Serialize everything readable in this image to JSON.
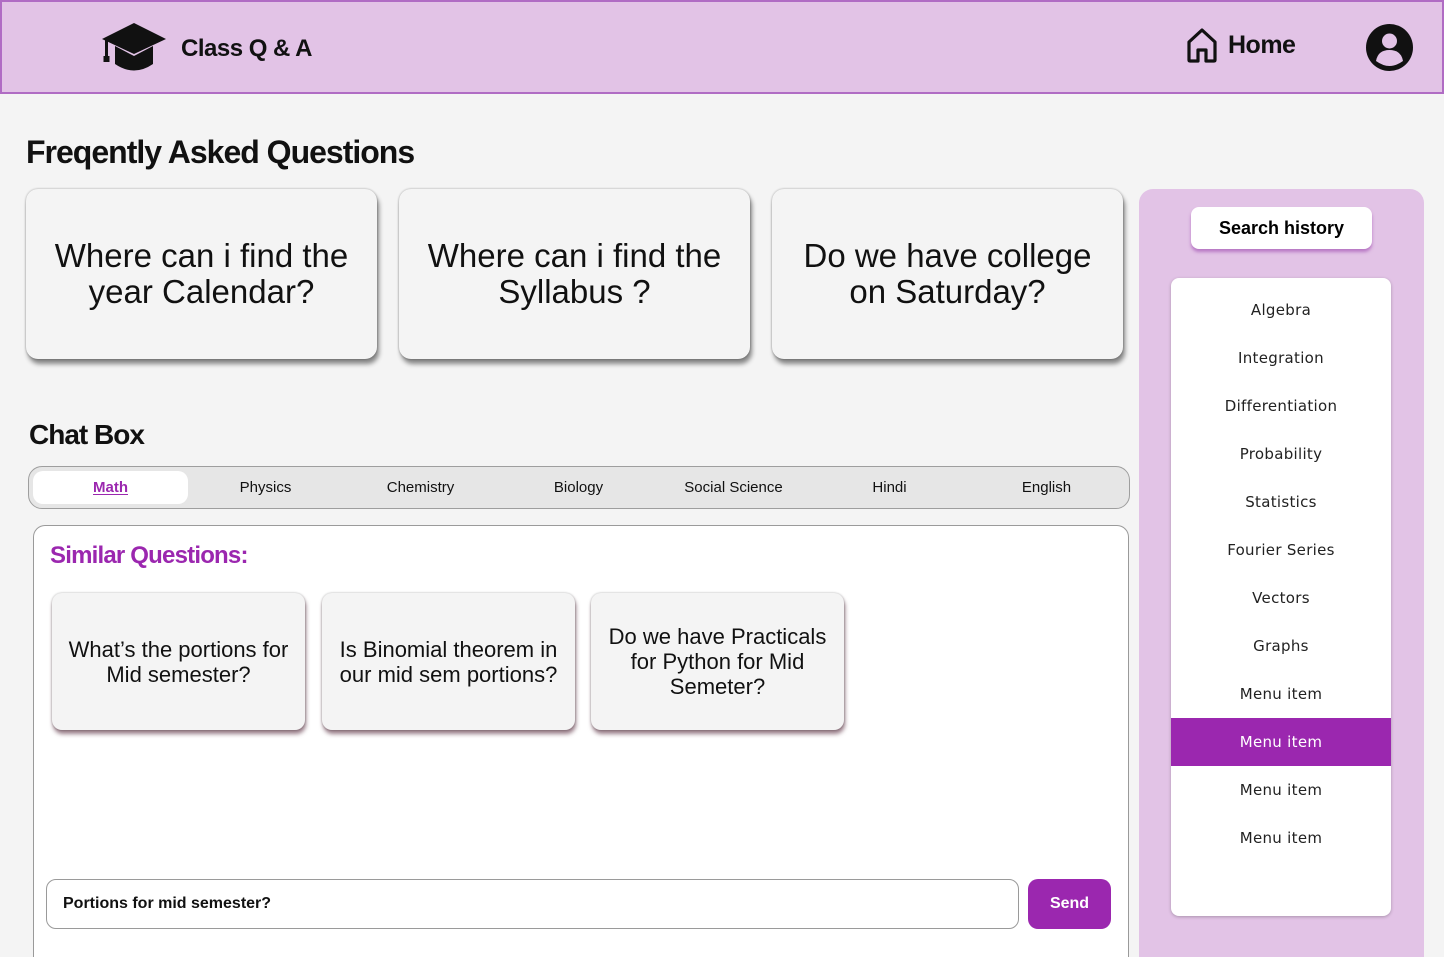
{
  "header": {
    "app_name": "Class Q & A",
    "logo_icon": "graduation-cap-icon",
    "home_label": "Home",
    "home_icon": "home-icon",
    "avatar_icon": "user-avatar-icon"
  },
  "faq": {
    "title": "Freqently Asked Questions",
    "cards": [
      "Where can i find the year Calendar?",
      "Where can i find the Syllabus ?",
      "Do we have college on Saturday?"
    ]
  },
  "chat": {
    "title": "Chat Box",
    "tabs": [
      "Math",
      "Physics",
      "Chemistry",
      "Biology",
      "Social Science",
      "Hindi",
      "English"
    ],
    "active_tab": "Math",
    "similar_title": "Similar Questions:",
    "similar": [
      "What’s the portions for Mid semester?",
      "Is Binomial theorem in our mid sem portions?",
      "Do we have Practicals for Python for Mid Semeter?"
    ],
    "input_value": "Portions for mid semester?",
    "send_label": "Send"
  },
  "sidebar": {
    "history_label": "Search history",
    "items": [
      "Algebra",
      "Integration",
      "Differentiation",
      "Probability",
      "Statistics",
      "Fourier Series",
      "Vectors",
      "Graphs",
      "Menu item",
      "Menu item",
      "Menu item",
      "Menu item"
    ],
    "selected_index": 9
  },
  "colors": {
    "accent": "#9b27af",
    "header_bg": "#e2c3e6",
    "page_bg": "#f4f4f4"
  }
}
